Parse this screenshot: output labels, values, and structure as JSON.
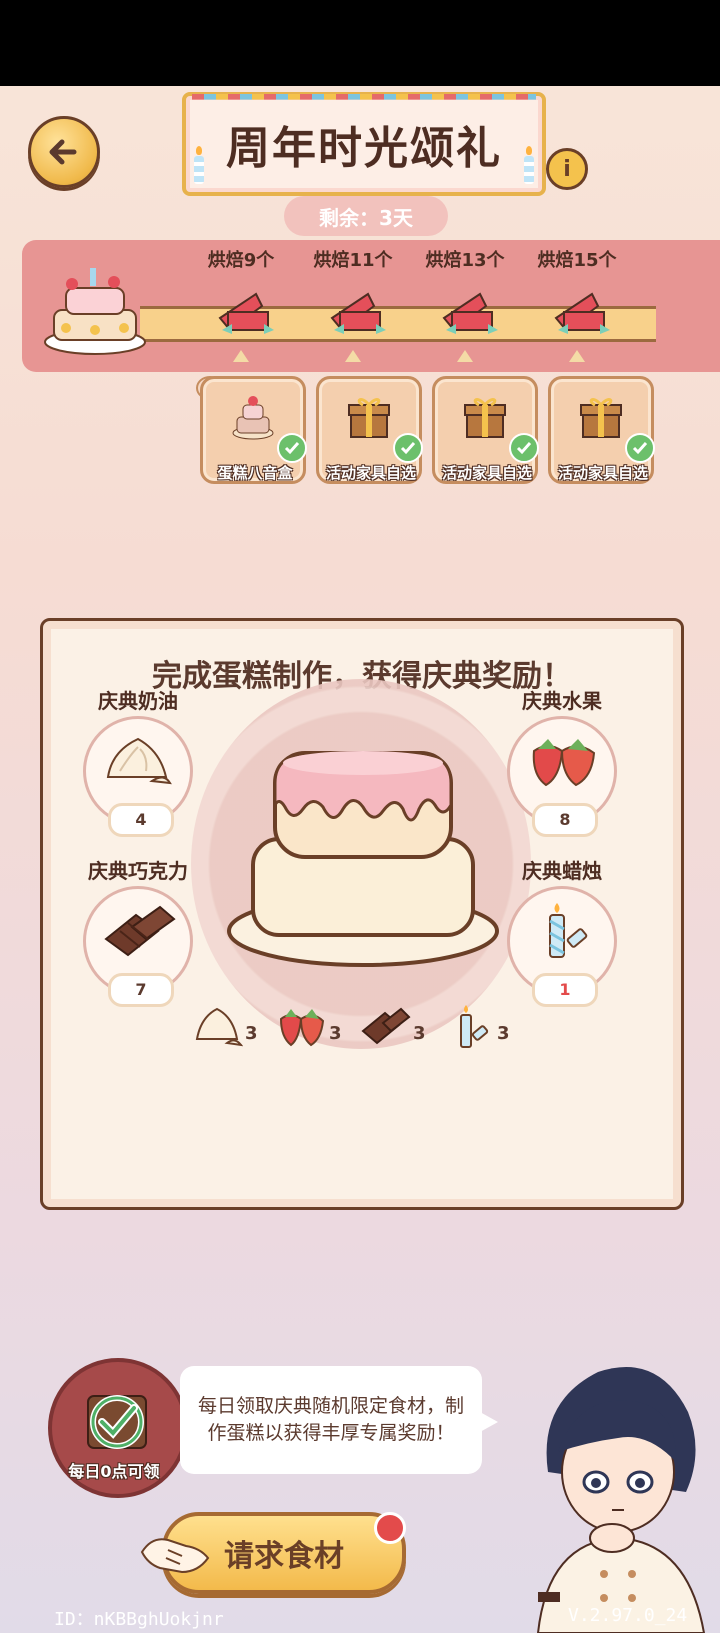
{
  "header": {
    "title": "周年时光颂礼",
    "remaining": "剩余：3天",
    "info_label": "i"
  },
  "milestones": [
    {
      "label": "烘焙9个",
      "reward": "蛋糕八音盒",
      "claimed": true
    },
    {
      "label": "烘焙11个",
      "reward": "活动家具自选",
      "claimed": true
    },
    {
      "label": "烘焙13个",
      "reward": "活动家具自选",
      "claimed": true
    },
    {
      "label": "烘焙15个",
      "reward": "活动家具自选",
      "claimed": true
    }
  ],
  "panel": {
    "title": "完成蛋糕制作，获得庆典奖励！",
    "ingredients": [
      {
        "name": "庆典奶油",
        "count": "4",
        "icon": "cream-icon"
      },
      {
        "name": "庆典水果",
        "count": "8",
        "icon": "strawberry-icon"
      },
      {
        "name": "庆典巧克力",
        "count": "7",
        "icon": "chocolate-icon"
      },
      {
        "name": "庆典蜡烛",
        "count": "1",
        "icon": "candle-icon",
        "insufficient": true
      }
    ],
    "requirements": [
      {
        "icon": "cream-icon",
        "count": "3"
      },
      {
        "icon": "strawberry-icon",
        "count": "3"
      },
      {
        "icon": "chocolate-icon",
        "count": "3"
      },
      {
        "icon": "candle-icon",
        "count": "3"
      }
    ]
  },
  "daily": {
    "label": "每日0点可领",
    "tip": "每日领取庆典随机限定食材，制作蛋糕以获得丰厚专属奖励！"
  },
  "request_button": "请求食材",
  "footer": {
    "player_id": "ID：nKBBghUokjnr",
    "version": "V.2.97.0_24"
  },
  "colors": {
    "strip": "#e79593",
    "accent_gold": "#f3ba4b",
    "check_green": "#6cc06b",
    "warning_red": "#e34b4b"
  }
}
